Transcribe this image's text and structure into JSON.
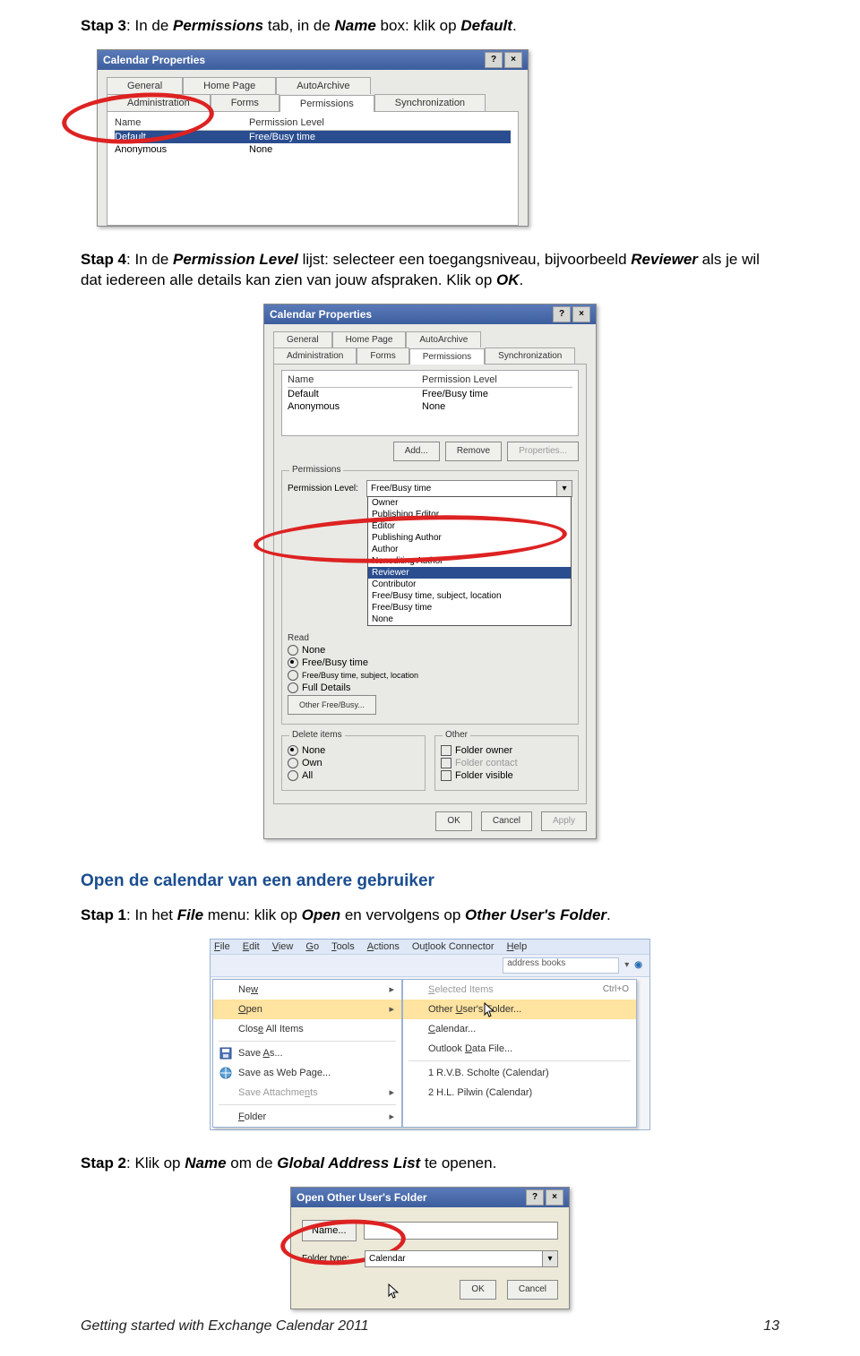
{
  "steps": {
    "s3_a": "Stap 3",
    "s3_b": ": In de ",
    "s3_c": "Permissions",
    "s3_d": " tab, in de ",
    "s3_e": "Name",
    "s3_f": " box: klik op ",
    "s3_g": "Default",
    "s3_h": ".",
    "s4_a": "Stap 4",
    "s4_b": ":   In de ",
    "s4_c": "Permission Level",
    "s4_d": " lijst: selecteer een toegangsniveau, bijvoorbeeld ",
    "s4_e": "Reviewer",
    "s4_f": " als je wil dat iedereen alle details kan zien van jouw afspraken. Klik op ",
    "s4_g": "OK",
    "s4_h": ".",
    "sec": "Open de calendar van een andere gebruiker",
    "s1_a": "Stap 1",
    "s1_b": ":   In het ",
    "s1_c": "File",
    "s1_d": " menu: klik op ",
    "s1_e": "Open",
    "s1_f": " en vervolgens  op ",
    "s1_g": "Other User's Folder",
    "s1_h": ".",
    "s2_a": "Stap 2",
    "s2_b": ":   Klik op ",
    "s2_c": "Name",
    "s2_d": " om de ",
    "s2_e": "Global Address List",
    "s2_f": " te openen."
  },
  "fig1": {
    "title": "Calendar Properties",
    "tabs_top": [
      "General",
      "Home Page",
      "AutoArchive"
    ],
    "tabs_bot": [
      "Administration",
      "Forms",
      "Permissions",
      "Synchronization"
    ],
    "hdr": [
      "Name",
      "Permission Level"
    ],
    "rows": [
      [
        "Default",
        "Free/Busy time"
      ],
      [
        "Anonymous",
        "None"
      ]
    ]
  },
  "fig2": {
    "title": "Calendar Properties",
    "tabs_top": [
      "General",
      "Home Page",
      "AutoArchive"
    ],
    "tabs_bot": [
      "Administration",
      "Forms",
      "Permissions",
      "Synchronization"
    ],
    "hdr": [
      "Name",
      "Permission Level"
    ],
    "rows": [
      [
        "Default",
        "Free/Busy time"
      ],
      [
        "Anonymous",
        "None"
      ]
    ],
    "add": "Add...",
    "remove": "Remove",
    "props": "Properties...",
    "perm_grp": "Permissions",
    "pl_lbl": "Permission Level:",
    "pl_val": "Free/Busy time",
    "pl_opts": [
      "Owner",
      "Publishing Editor",
      "Editor",
      "Publishing Author",
      "Author",
      "Nonediting Author",
      "Reviewer",
      "Contributor",
      "Free/Busy time, subject, location",
      "Free/Busy time",
      "None"
    ],
    "read": "Read",
    "r1": "None",
    "r2": "Free/Busy time",
    "r3": "Free/Busy time, subject, location",
    "r4": "Full Details",
    "r5": "Other Free/Busy...",
    "del": "Delete items",
    "d1": "None",
    "d2": "Own",
    "d3": "All",
    "other": "Other",
    "o1": "Folder owner",
    "o2": "Folder contact",
    "o3": "Folder visible",
    "ok": "OK",
    "cancel": "Cancel",
    "apply": "Apply"
  },
  "fig3": {
    "menubar": [
      "File",
      "Edit",
      "View",
      "Go",
      "Tools",
      "Actions",
      "Outlook Connector",
      "Help"
    ],
    "search_ph": "address books",
    "left": [
      {
        "t": "New",
        "arrow": true
      },
      {
        "t": "Open",
        "arrow": true,
        "hi": true
      },
      {
        "t": "Close All Items"
      },
      {
        "t": "Save As...",
        "icon": "save"
      },
      {
        "t": "Save as Web Page...",
        "icon": "web"
      },
      {
        "t": "Save Attachments",
        "dis": true,
        "arrow": true
      },
      {
        "t": "Folder",
        "arrow": true
      }
    ],
    "right": [
      {
        "t": "Selected Items",
        "sc": "Ctrl+O",
        "dis": true
      },
      {
        "t": "Other User's Folder...",
        "hi": true
      },
      {
        "t": "Calendar..."
      },
      {
        "t": "Outlook Data File..."
      },
      {
        "t": "1 R.V.B. Scholte (Calendar)"
      },
      {
        "t": "2 H.L. Pilwin (Calendar)"
      }
    ]
  },
  "fig4": {
    "title": "Open Other User's Folder",
    "name": "Name...",
    "ftype": "Folder type:",
    "ftv": "Calendar",
    "ok": "OK",
    "cancel": "Cancel"
  },
  "footer": {
    "left": "Getting started with Exchange Calendar 2011",
    "right": "13"
  }
}
